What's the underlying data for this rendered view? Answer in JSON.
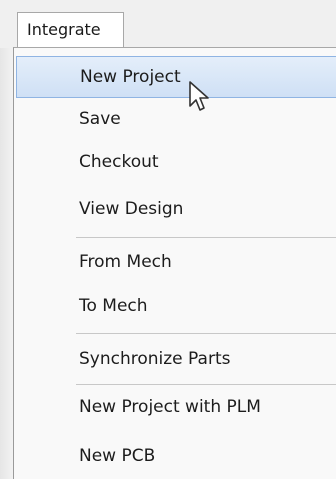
{
  "menubar": {
    "active_menu": "Integrate"
  },
  "menu": {
    "items": [
      {
        "label": "New Project"
      },
      {
        "label": "Save"
      },
      {
        "label": "Checkout"
      },
      {
        "label": "View Design"
      },
      {
        "label": "From Mech"
      },
      {
        "label": "To Mech"
      },
      {
        "label": "Synchronize Parts"
      },
      {
        "label": "New Project with PLM"
      },
      {
        "label": "New PCB"
      }
    ],
    "highlighted_item": "New Project"
  },
  "colors": {
    "highlight_fill": "#d6e5f7",
    "highlight_border": "#8fb4e3",
    "menu_background": "#f9f9f9",
    "separator": "#c8c8c8"
  },
  "icons": [
    "mouse-pointer-icon"
  ]
}
